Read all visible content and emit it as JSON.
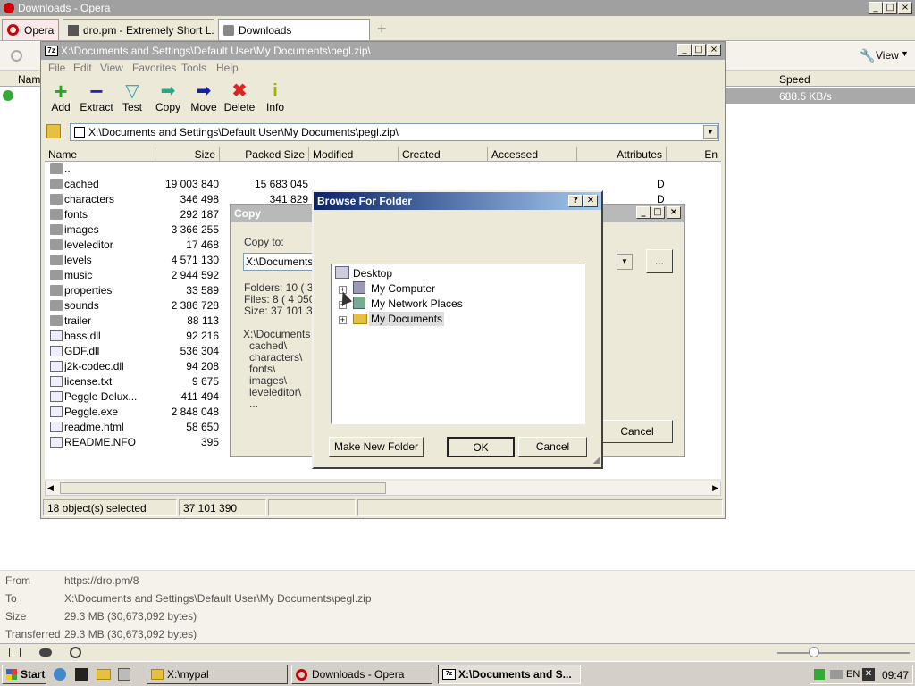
{
  "opera": {
    "title": "Downloads - Opera",
    "menu_button": "Opera",
    "tabs": [
      "dro.pm - Extremely Short L...",
      "Downloads"
    ],
    "view_label": "View",
    "columns": {
      "name": "Name",
      "speed": "Speed"
    },
    "download_speed": "688.5 KB/s",
    "info": {
      "from_label": "From",
      "from": "https://dro.pm/8",
      "to_label": "To",
      "to": "X:\\Documents and Settings\\Default User\\My Documents\\pegl.zip",
      "size_label": "Size",
      "size": "29.3 MB (30,673,092 bytes)",
      "transferred_label": "Transferred",
      "transferred": "29.3 MB (30,673,092 bytes)"
    }
  },
  "zip": {
    "title": "X:\\Documents and Settings\\Default User\\My Documents\\pegl.zip\\",
    "menu": [
      "File",
      "Edit",
      "View",
      "Favorites",
      "Tools",
      "Help"
    ],
    "toolbar": [
      "Add",
      "Extract",
      "Test",
      "Copy",
      "Move",
      "Delete",
      "Info"
    ],
    "address": "X:\\Documents and Settings\\Default User\\My Documents\\pegl.zip\\",
    "columns": [
      "Name",
      "Size",
      "Packed Size",
      "Modified",
      "Created",
      "Accessed",
      "Attributes",
      "En"
    ],
    "files": [
      {
        "name": "..",
        "size": "",
        "packed": "",
        "attr": "",
        "type": "folder"
      },
      {
        "name": "cached",
        "size": "19 003 840",
        "packed": "15 683 045",
        "attr": "D",
        "type": "folder"
      },
      {
        "name": "characters",
        "size": "346 498",
        "packed": "341 829",
        "attr": "D",
        "type": "folder"
      },
      {
        "name": "fonts",
        "size": "292 187",
        "packed": "",
        "attr": "",
        "type": "folder"
      },
      {
        "name": "images",
        "size": "3 366 255",
        "packed": "",
        "attr": "",
        "type": "folder"
      },
      {
        "name": "leveleditor",
        "size": "17 468",
        "packed": "",
        "attr": "",
        "type": "folder"
      },
      {
        "name": "levels",
        "size": "4 571 130",
        "packed": "",
        "attr": "",
        "type": "folder"
      },
      {
        "name": "music",
        "size": "2 944 592",
        "packed": "",
        "attr": "",
        "type": "folder"
      },
      {
        "name": "properties",
        "size": "33 589",
        "packed": "",
        "attr": "",
        "type": "folder"
      },
      {
        "name": "sounds",
        "size": "2 386 728",
        "packed": "",
        "attr": "",
        "type": "folder"
      },
      {
        "name": "trailer",
        "size": "88 113",
        "packed": "",
        "attr": "",
        "type": "folder"
      },
      {
        "name": "bass.dll",
        "size": "92 216",
        "packed": "",
        "attr": "",
        "type": "file"
      },
      {
        "name": "GDF.dll",
        "size": "536 304",
        "packed": "",
        "attr": "",
        "type": "file"
      },
      {
        "name": "j2k-codec.dll",
        "size": "94 208",
        "packed": "",
        "attr": "",
        "type": "file"
      },
      {
        "name": "license.txt",
        "size": "9 675",
        "packed": "",
        "attr": "",
        "type": "file"
      },
      {
        "name": "Peggle Delux...",
        "size": "411 494",
        "packed": "",
        "attr": "",
        "type": "file"
      },
      {
        "name": "Peggle.exe",
        "size": "2 848 048",
        "packed": "",
        "attr": "",
        "type": "file"
      },
      {
        "name": "readme.html",
        "size": "58 650",
        "packed": "",
        "attr": "",
        "type": "file"
      },
      {
        "name": "README.NFO",
        "size": "395",
        "packed": "",
        "attr": "",
        "type": "file"
      }
    ],
    "status": {
      "selected": "18 object(s) selected",
      "total": "37 101 390"
    }
  },
  "copy": {
    "title": "Copy",
    "copy_to_label": "Copy to:",
    "path": "X:\\Documents a",
    "folders": "Folders: 10   ( 3",
    "files": "Files: 8    ( 4 050",
    "size": "Size: 37 101 390",
    "list": [
      "X:\\Documents a",
      "cached\\",
      "characters\\",
      "fonts\\",
      "images\\",
      "leveleditor\\",
      "..."
    ],
    "browse_label": "...",
    "cancel_label": "Cancel"
  },
  "browse": {
    "title": "Browse For Folder",
    "tree": [
      {
        "label": "Desktop",
        "level": 0
      },
      {
        "label": "My Computer",
        "level": 1
      },
      {
        "label": "My Network Places",
        "level": 1
      },
      {
        "label": "My Documents",
        "level": 1,
        "selected": true
      }
    ],
    "new_folder_label": "Make New Folder",
    "ok_label": "OK",
    "cancel_label": "Cancel",
    "help_label": "?",
    "close_label": "✕"
  },
  "taskbar": {
    "start_label": "Start",
    "tasks": [
      "X:\\mypal",
      "Downloads - Opera",
      "X:\\Documents and S..."
    ],
    "lang": "EN",
    "clock": "09:47"
  }
}
